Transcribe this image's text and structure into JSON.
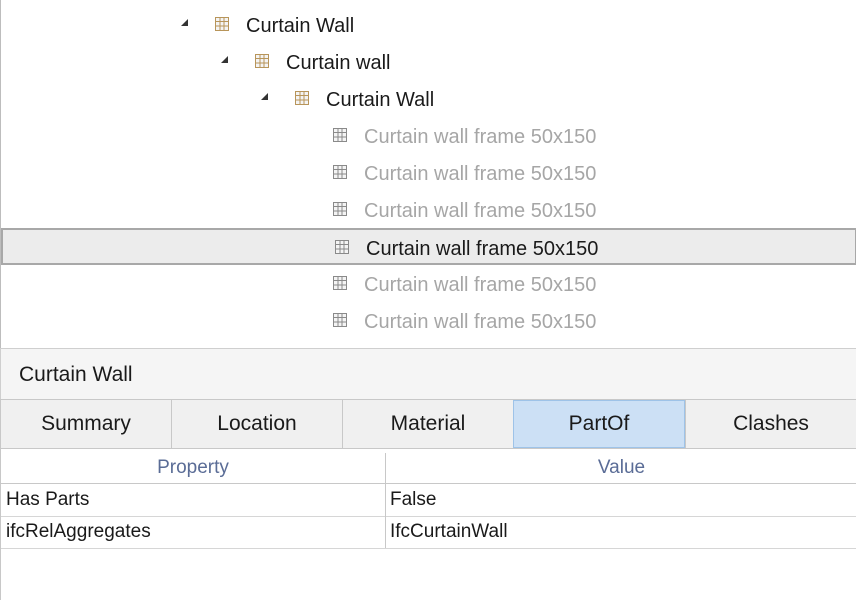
{
  "tree": {
    "nodes": [
      {
        "label": "Curtain Wall",
        "expanded": true,
        "dim": false,
        "selected": false,
        "icon": "curtain-wall-icon"
      },
      {
        "label": "Curtain wall",
        "expanded": true,
        "dim": false,
        "selected": false,
        "icon": "curtain-wall-icon"
      },
      {
        "label": "Curtain Wall",
        "expanded": true,
        "dim": false,
        "selected": false,
        "icon": "curtain-wall-icon"
      },
      {
        "label": "Curtain wall frame 50x150",
        "expanded": false,
        "dim": true,
        "selected": false,
        "icon": "curtain-wall-frame-icon"
      },
      {
        "label": "Curtain wall frame 50x150",
        "expanded": false,
        "dim": true,
        "selected": false,
        "icon": "curtain-wall-frame-icon"
      },
      {
        "label": "Curtain wall frame 50x150",
        "expanded": false,
        "dim": true,
        "selected": false,
        "icon": "curtain-wall-frame-icon"
      },
      {
        "label": "Curtain wall frame 50x150",
        "expanded": false,
        "dim": false,
        "selected": true,
        "icon": "curtain-wall-frame-icon"
      },
      {
        "label": "Curtain wall frame 50x150",
        "expanded": false,
        "dim": true,
        "selected": false,
        "icon": "curtain-wall-frame-icon"
      },
      {
        "label": "Curtain wall frame 50x150",
        "expanded": false,
        "dim": true,
        "selected": false,
        "icon": "curtain-wall-frame-icon"
      }
    ]
  },
  "panel": {
    "title": "Curtain Wall",
    "tabs": [
      {
        "label": "Summary",
        "active": false
      },
      {
        "label": "Location",
        "active": false
      },
      {
        "label": "Material",
        "active": false
      },
      {
        "label": "PartOf",
        "active": true
      },
      {
        "label": "Clashes",
        "active": false
      }
    ],
    "grid": {
      "headers": {
        "property": "Property",
        "value": "Value"
      },
      "rows": [
        {
          "property": "Has Parts",
          "value": "False"
        },
        {
          "property": "ifcRelAggregates",
          "value": "IfcCurtainWall"
        }
      ]
    }
  },
  "colors": {
    "accent_tab": "#cce0f5",
    "header_text": "#5a6c96",
    "dim_text": "#a6a6a6",
    "wall_icon": "#b8955a",
    "frame_icon": "#8a8a8a"
  }
}
